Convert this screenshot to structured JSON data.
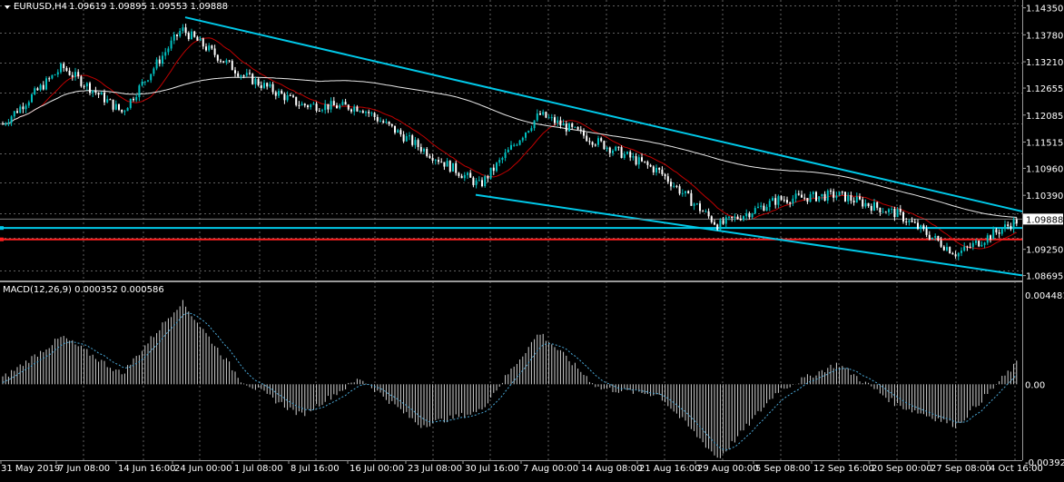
{
  "chart_header": {
    "symbol_label": "EURUSD,H4",
    "ohlc": "1.09619 1.09895 1.09553 1.09888"
  },
  "macd_header": {
    "label": "MACD(12,26,9) 0.000352 0.000586"
  },
  "price_axis": {
    "ticks": [
      "1.14350",
      "1.13780",
      "1.13210",
      "1.12655",
      "1.12085",
      "1.11515",
      "1.10960",
      "1.10390",
      "1.09250",
      "1.08695"
    ],
    "ylim": [
      1.0863,
      1.144
    ],
    "current_price_tag": "1.09888"
  },
  "macd_axis": {
    "ticks": [
      "0.004481",
      "0.00",
      "-0.003925"
    ],
    "ylim": [
      -0.003925,
      0.004481
    ]
  },
  "time_axis": {
    "labels": [
      "31 May 2019",
      "7 Jun 08:00",
      "14 Jun 16:00",
      "24 Jun 00:00",
      "1 Jul 08:00",
      "8 Jul 16:00",
      "16 Jul 00:00",
      "23 Jul 08:00",
      "30 Jul 16:00",
      "7 Aug 00:00",
      "14 Aug 08:00",
      "21 Aug 16:00",
      "29 Aug 00:00",
      "5 Sep 08:00",
      "12 Sep 16:00",
      "20 Sep 00:00",
      "27 Sep 08:00",
      "4 Oct 16:00"
    ]
  },
  "colors": {
    "background": "#000000",
    "bull_candle": "#00c0c0",
    "bear_candle": "#ffffff",
    "ma_fast": "#c00000",
    "ma_slow": "#e8e8e8",
    "trendline": "#00c8e8",
    "support_line": "#ff2020",
    "grid": "#606060",
    "macd_hist": "#d0d0d0",
    "macd_signal": "#4aa8d8"
  },
  "chart_data": {
    "type": "candlestick",
    "symbol": "EURUSD",
    "timeframe": "H4",
    "overlays": [
      "moving average (fast, red)",
      "moving average (slow, white)",
      "descending trendline channel (cyan)",
      "horizontal line 1.0970 (cyan)",
      "horizontal line 1.0946 (red)"
    ],
    "horizontal_levels": [
      1.097,
      1.0946
    ],
    "trendlines": [
      {
        "from": [
          "24 Jun 00:00",
          1.1415
        ],
        "to": [
          "4 Oct 16:00",
          1.1005
        ]
      },
      {
        "from": [
          "30 Jul 16:00",
          1.104
        ],
        "to": [
          "4 Oct 16:00",
          1.087
        ]
      }
    ],
    "close_path": [
      [
        "31 May 2019",
        1.119
      ],
      [
        "7 Jun 08:00",
        1.131
      ],
      [
        "14 Jun 16:00",
        1.1215
      ],
      [
        "24 Jun 00:00",
        1.139
      ],
      [
        "1 Jul 08:00",
        1.1295
      ],
      [
        "8 Jul 16:00",
        1.123
      ],
      [
        "16 Jul 00:00",
        1.1225
      ],
      [
        "23 Jul 08:00",
        1.114
      ],
      [
        "30 Jul 16:00",
        1.106
      ],
      [
        "7 Aug 00:00",
        1.121
      ],
      [
        "14 Aug 08:00",
        1.115
      ],
      [
        "21 Aug 16:00",
        1.109
      ],
      [
        "29 Aug 00:00",
        1.0975
      ],
      [
        "5 Sep 08:00",
        1.103
      ],
      [
        "12 Sep 16:00",
        1.104
      ],
      [
        "20 Sep 00:00",
        1.1
      ],
      [
        "27 Sep 08:00",
        1.0915
      ],
      [
        "4 Oct 16:00",
        1.0985
      ]
    ],
    "macd_path": [
      [
        "31 May 2019",
        0.0003
      ],
      [
        "7 Jun 08:00",
        0.0023
      ],
      [
        "14 Jun 16:00",
        0.0005
      ],
      [
        "24 Jun 00:00",
        0.004
      ],
      [
        "1 Jul 08:00",
        0.0002
      ],
      [
        "8 Jul 16:00",
        -0.0015
      ],
      [
        "16 Jul 00:00",
        0.0003
      ],
      [
        "23 Jul 08:00",
        -0.002
      ],
      [
        "30 Jul 16:00",
        -0.0013
      ],
      [
        "7 Aug 00:00",
        0.0025
      ],
      [
        "14 Aug 08:00",
        -0.0002
      ],
      [
        "21 Aug 16:00",
        -0.0005
      ],
      [
        "29 Aug 00:00",
        -0.0036
      ],
      [
        "5 Sep 08:00",
        -0.0003
      ],
      [
        "12 Sep 16:00",
        0.001
      ],
      [
        "20 Sep 00:00",
        -0.001
      ],
      [
        "27 Sep 08:00",
        -0.002
      ],
      [
        "4 Oct 16:00",
        0.001
      ]
    ]
  }
}
